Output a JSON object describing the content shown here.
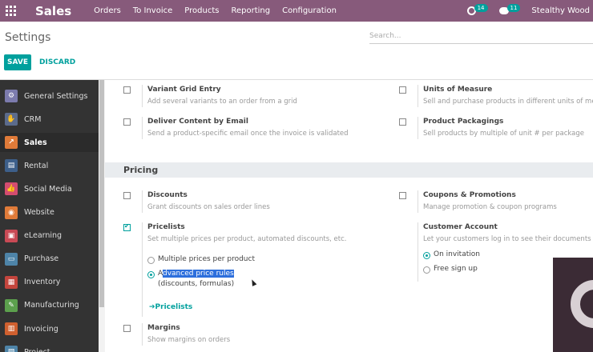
{
  "topbar": {
    "app_name": "Sales",
    "menu": [
      "Orders",
      "To Invoice",
      "Products",
      "Reporting",
      "Configuration"
    ],
    "activity_count": "14",
    "message_count": "11",
    "user": "Stealthy Wood",
    "color": "#875a7b"
  },
  "control": {
    "breadcrumb": "Settings",
    "search_placeholder": "Search...",
    "save_label": "SAVE",
    "discard_label": "DISCARD",
    "accent": "#00a09d"
  },
  "sidebar": {
    "items": [
      {
        "label": "General Settings",
        "icon": "gear-icon",
        "color": "#7c7bad"
      },
      {
        "label": "CRM",
        "icon": "handshake-icon",
        "color": "#5b6b8c"
      },
      {
        "label": "Sales",
        "icon": "chart-icon",
        "color": "#e07b39"
      },
      {
        "label": "Rental",
        "icon": "rental-icon",
        "color": "#3d5f8a"
      },
      {
        "label": "Social Media",
        "icon": "thumbs-up-icon",
        "color": "#d44c6f"
      },
      {
        "label": "Website",
        "icon": "globe-icon",
        "color": "#e07b39"
      },
      {
        "label": "eLearning",
        "icon": "elearning-icon",
        "color": "#c94a55"
      },
      {
        "label": "Purchase",
        "icon": "purchase-icon",
        "color": "#4e84a8"
      },
      {
        "label": "Inventory",
        "icon": "box-icon",
        "color": "#c4453d"
      },
      {
        "label": "Manufacturing",
        "icon": "wrench-icon",
        "color": "#5ca04d"
      },
      {
        "label": "Invoicing",
        "icon": "invoice-icon",
        "color": "#d0602f"
      },
      {
        "label": "Project",
        "icon": "project-icon",
        "color": "#4e84a8"
      }
    ]
  },
  "settings": {
    "variant_grid": {
      "title": "Variant Grid Entry",
      "desc": "Add several variants to an order from a grid"
    },
    "units_of_measure": {
      "title": "Units of Measure",
      "desc": "Sell and purchase products in different units of me"
    },
    "deliver_content": {
      "title": "Deliver Content by Email",
      "desc": "Send a product-specific email once the invoice is validated"
    },
    "product_packagings": {
      "title": "Product Packagings",
      "desc": "Sell products by multiple of unit # per package"
    },
    "pricing_section": "Pricing",
    "discounts": {
      "title": "Discounts",
      "desc": "Grant discounts on sales order lines"
    },
    "coupons": {
      "title": "Coupons & Promotions",
      "desc": "Manage promotion & coupon programs"
    },
    "pricelists": {
      "title": "Pricelists",
      "desc": "Set multiple prices per product, automated discounts, etc.",
      "option1": "Multiple prices per product",
      "option2_prefix": "A",
      "option2_selected": "dvanced price rules",
      "option2_sub": "(discounts, formulas)",
      "link": "Pricelists"
    },
    "customer_account": {
      "title": "Customer Account",
      "desc": "Let your customers log in to see their documents",
      "option1": "On invitation",
      "option2": "Free sign up"
    },
    "margins": {
      "title": "Margins",
      "desc": "Show margins on orders"
    }
  }
}
